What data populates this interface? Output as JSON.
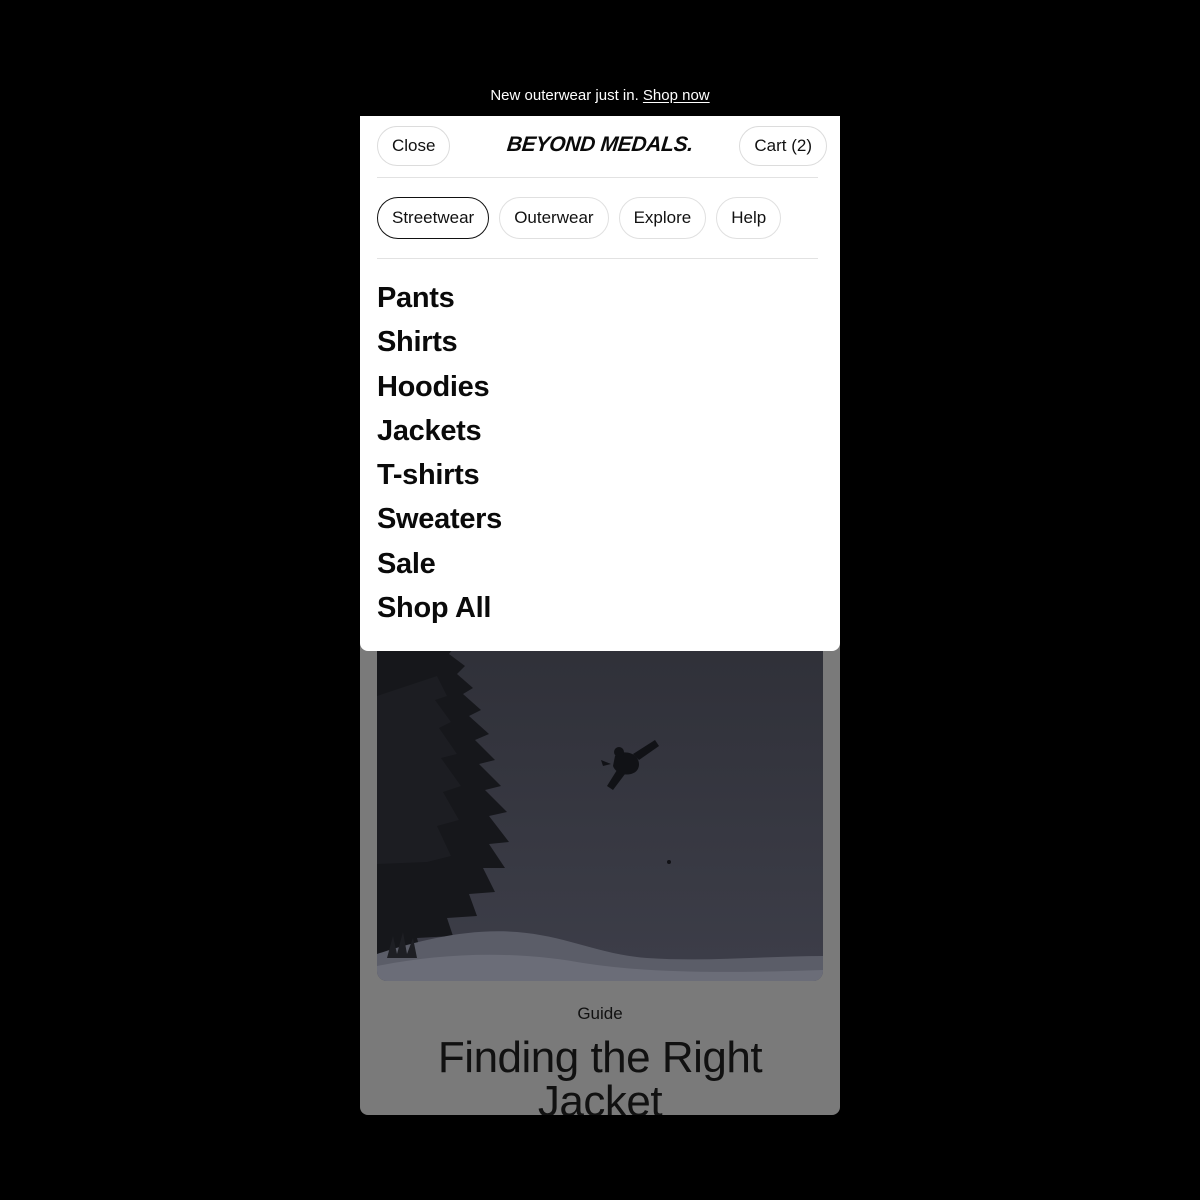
{
  "announcement": {
    "text": "New outerwear just in.",
    "link": "Shop now"
  },
  "header": {
    "close_label": "Close",
    "logo": "BEYOND MEDALS.",
    "cart_label": "Cart (2)"
  },
  "tabs": [
    {
      "label": "Streetwear",
      "active": true
    },
    {
      "label": "Outerwear",
      "active": false
    },
    {
      "label": "Explore",
      "active": false
    },
    {
      "label": "Help",
      "active": false
    }
  ],
  "categories": [
    "Pants",
    "Shirts",
    "Hoodies",
    "Jackets",
    "T-shirts",
    "Sweaters",
    "Sale",
    "Shop All"
  ],
  "article": {
    "eyebrow": "Guide",
    "title": "Finding the Right Jacket"
  },
  "colors": {
    "background": "#000000",
    "menu": "#ffffff",
    "overlay_page": "#7a7a7a",
    "text": "#0a0a0a"
  }
}
